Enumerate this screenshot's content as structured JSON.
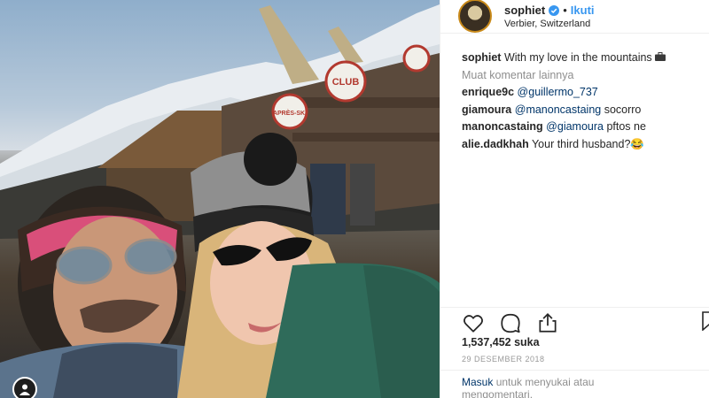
{
  "post": {
    "username": "sophiet",
    "follow_label": "Ikuti",
    "separator": "•",
    "location": "Verbier, Switzerland",
    "sign_club": "CLUB",
    "sign_apres": "APRÈS-SKI"
  },
  "caption": {
    "username": "sophiet",
    "text": "With my love in the mountains"
  },
  "load_more": "Muat komentar lainnya",
  "comments": [
    {
      "user": "enrique9c",
      "mention": "@guillermo_737",
      "text": ""
    },
    {
      "user": "giamoura",
      "mention": "@manoncastaing",
      "text": " socorro"
    },
    {
      "user": "manoncastaing",
      "mention": "@giamoura",
      "text": " pftos ne"
    },
    {
      "user": "alie.dadkhah",
      "mention": "",
      "text": "Your third husband?😂"
    }
  ],
  "likes": "1,537,452 suka",
  "date": "29 DESEMBER 2018",
  "login": {
    "link": "Masuk",
    "text": "untuk menyukai atau mengomentari."
  },
  "colors": {
    "accent": "#3897f0",
    "mention": "#003569",
    "muted": "#8e8e8e"
  },
  "icons": [
    "heart-icon",
    "comment-icon",
    "share-icon",
    "bookmark-icon",
    "verified-icon",
    "user-tag-icon"
  ]
}
